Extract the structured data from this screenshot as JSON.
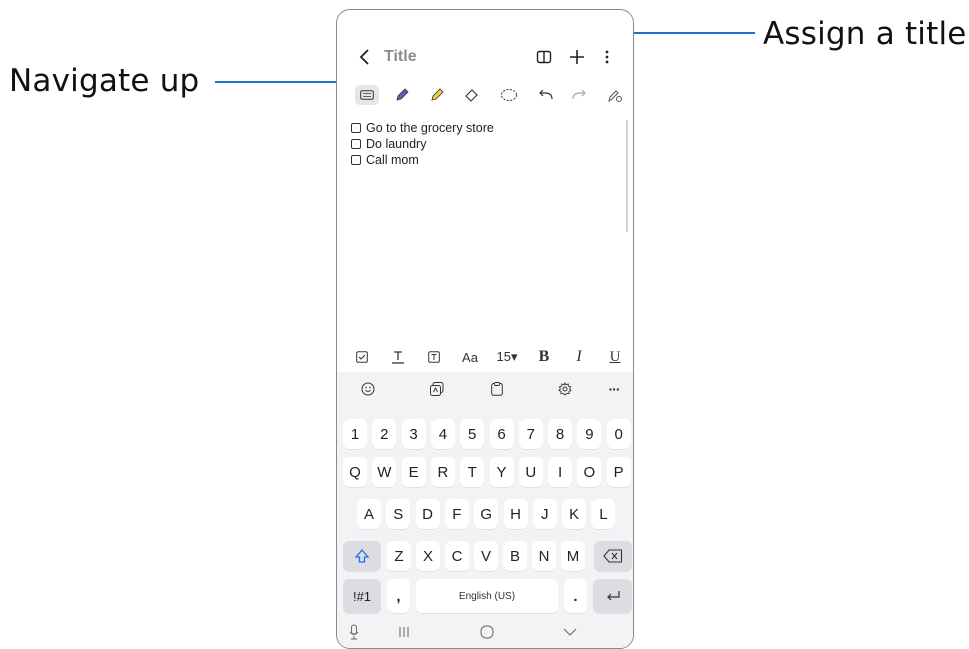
{
  "callouts": {
    "navigate_up": "Navigate up",
    "assign_title": "Assign a title"
  },
  "header": {
    "title_placeholder": "Title"
  },
  "note": {
    "items": [
      "Go to the grocery store",
      "Do laundry",
      "Call mom"
    ]
  },
  "format_bar": {
    "aa": "Aa",
    "font_size": "15▾",
    "bold": "B",
    "italic": "I",
    "underline": "U"
  },
  "keyboard": {
    "suggestion_more": "···",
    "row_numbers": [
      "1",
      "2",
      "3",
      "4",
      "5",
      "6",
      "7",
      "8",
      "9",
      "0"
    ],
    "row_q": [
      "Q",
      "W",
      "E",
      "R",
      "T",
      "Y",
      "U",
      "I",
      "O",
      "P"
    ],
    "row_a": [
      "A",
      "S",
      "D",
      "F",
      "G",
      "H",
      "J",
      "K",
      "L"
    ],
    "row_z": [
      "Z",
      "X",
      "C",
      "V",
      "B",
      "N",
      "M"
    ],
    "symbols_key": "!#1",
    "comma_key": ",",
    "space_key": "English (US)",
    "period_key": "."
  },
  "colors": {
    "leader": "#1e73c8",
    "keyboard_bg": "#f3f3f5",
    "key_bg": "#ffffff",
    "key_special_bg": "#dcdde2"
  }
}
